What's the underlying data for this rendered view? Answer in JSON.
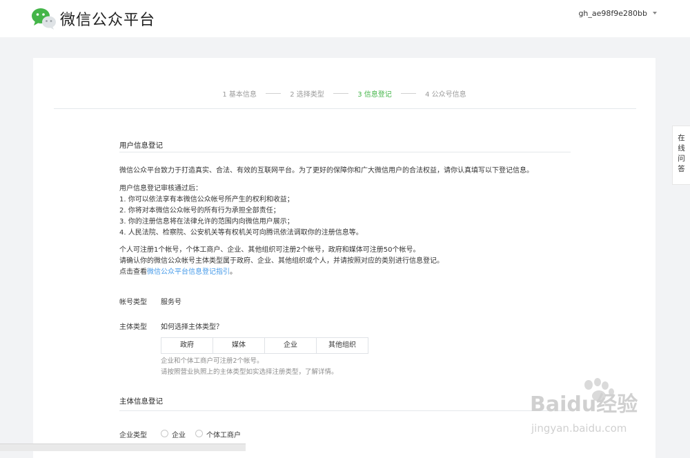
{
  "header": {
    "brand": "微信公众平台",
    "account": "gh_ae98f9e280bb",
    "logo_icon": "wechat-logo-icon"
  },
  "steps": [
    {
      "label": "1 基本信息",
      "active": false
    },
    {
      "label": "2 选择类型",
      "active": false
    },
    {
      "label": "3 信息登记",
      "active": true
    },
    {
      "label": "4 公众号信息",
      "active": false
    }
  ],
  "colors": {
    "accent": "#44b549",
    "link": "#459ae9"
  },
  "user_info": {
    "title": "用户信息登记",
    "intro": "微信公众平台致力于打造真实、合法、有效的互联网平台。为了更好的保障你和广大微信用户的合法权益，请你认真填写以下登记信息。",
    "after_title": "用户信息登记审核通过后：",
    "items": [
      "1. 你可以依法享有本微信公众帐号所产生的权利和收益；",
      "2. 你将对本微信公众帐号的所有行为承担全部责任；",
      "3. 你的注册信息将在法律允许的范围内向微信用户展示；",
      "4. 人民法院、检察院、公安机关等有权机关可向腾讯依法调取你的注册信息等。"
    ],
    "note1": "个人可注册1个帐号，个体工商户、企业、其他组织可注册2个帐号，政府和媒体可注册50个帐号。",
    "note2": "请确认你的微信公众帐号主体类型属于政府、企业、其他组织或个人，并请按照对应的类别进行信息登记。",
    "guide_prefix": "点击查看",
    "guide_link": "微信公众平台信息登记指引",
    "guide_suffix": "。"
  },
  "account_type": {
    "label": "帐号类型",
    "value": "服务号"
  },
  "subject_type": {
    "label": "主体类型",
    "help_link": "如何选择主体类型？",
    "options": [
      "政府",
      "媒体",
      "企业",
      "其他组织"
    ],
    "hint1": "企业和个体工商户可注册2个帐号。",
    "hint2": "请按照营业执照上的主体类型如实选择注册类型，了解详情。"
  },
  "subject_info": {
    "title": "主体信息登记"
  },
  "enterprise_type": {
    "label": "企业类型",
    "options": [
      "企业",
      "个体工商户"
    ]
  },
  "side_tab": [
    "在",
    "线",
    "问",
    "答"
  ],
  "watermark": {
    "brand": "Baidu经验",
    "url": "jingyan.baidu.com"
  }
}
